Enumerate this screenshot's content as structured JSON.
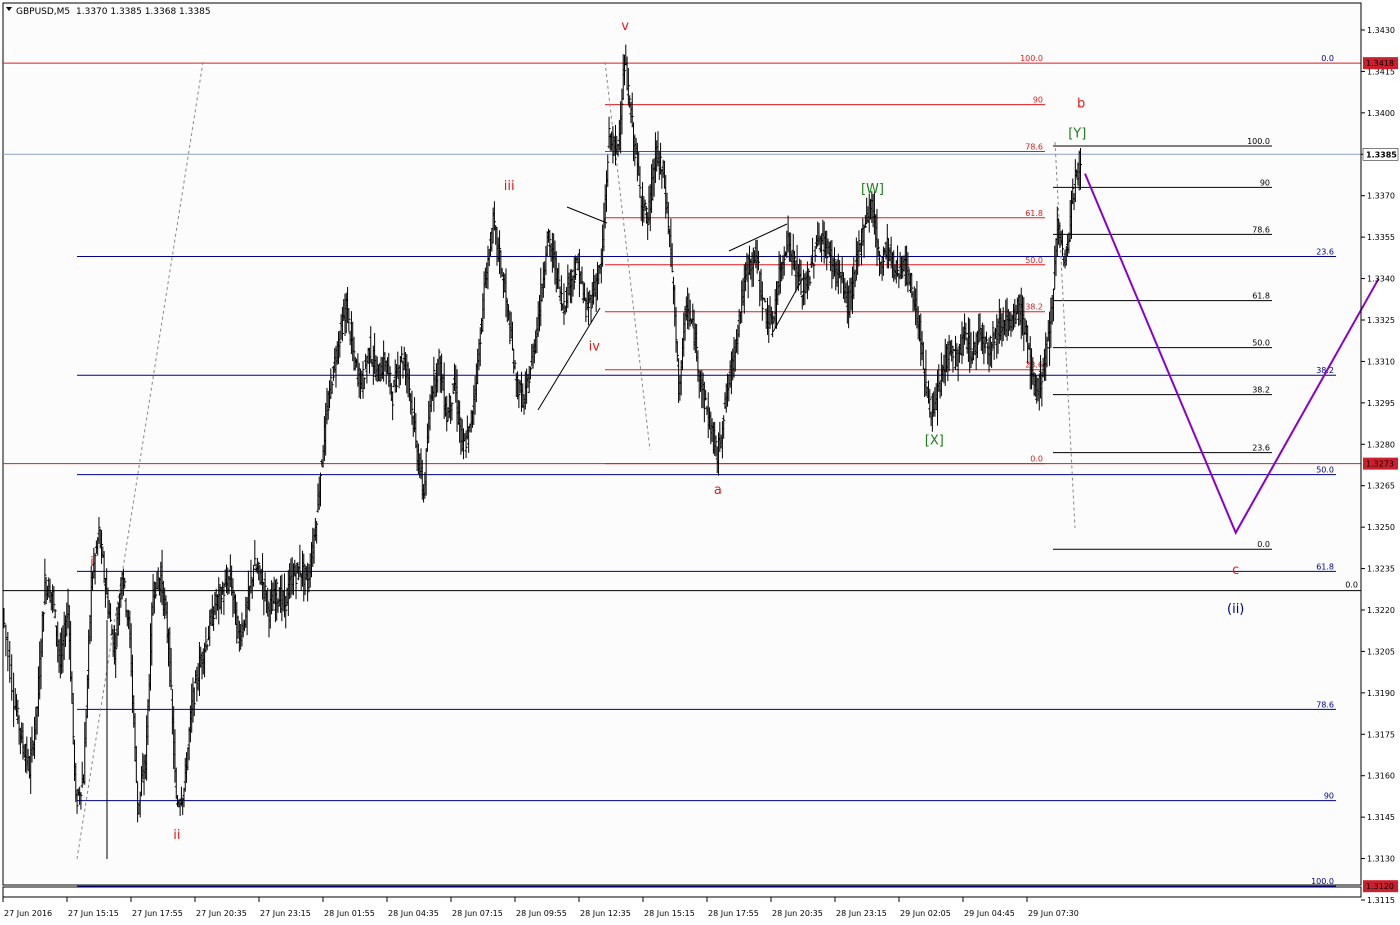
{
  "header": {
    "symbol": "GBPUSD,M5",
    "ohlc": "1.3370 1.3385 1.3368 1.3385"
  },
  "colors": {
    "bull": "#000000",
    "bear": "#000000",
    "fib_red": "#e31a1c",
    "fib_blue": "#00008b",
    "fib_black": "#000000",
    "bid_line": "#8da2c7",
    "projection": "#8b00c8",
    "wave_red": "#e31a1c",
    "wave_green": "#1e7d1e",
    "wave_blue": "#00008b",
    "trend_dotted": "#888888",
    "price_badge_bg": "#cc1f2d"
  },
  "chart_data": {
    "type": "candlestick",
    "symbol": "GBPUSD",
    "timeframe": "M5",
    "title": "GBPUSD,M5",
    "last_ohlc": {
      "open": 1.337,
      "high": 1.3385,
      "low": 1.3368,
      "close": 1.3385
    },
    "ylim": [
      1.3108,
      1.3442
    ],
    "y_ticks": [
      "1.3430",
      "1.3415",
      "1.3400",
      "1.3385",
      "1.3370",
      "1.3355",
      "1.3340",
      "1.3325",
      "1.3310",
      "1.3295",
      "1.3280",
      "1.3265",
      "1.3250",
      "1.3235",
      "1.3220",
      "1.3205",
      "1.3190",
      "1.3175",
      "1.3160",
      "1.3145",
      "1.3130",
      "1.3115"
    ],
    "x_ticks": [
      "27 Jun 2016",
      "27 Jun 15:15",
      "27 Jun 17:55",
      "27 Jun 20:35",
      "27 Jun 23:15",
      "28 Jun 01:55",
      "28 Jun 04:35",
      "28 Jun 07:15",
      "28 Jun 09:55",
      "28 Jun 12:35",
      "28 Jun 15:15",
      "28 Jun 17:55",
      "28 Jun 20:35",
      "28 Jun 23:15",
      "29 Jun 02:05",
      "29 Jun 04:45",
      "29 Jun 07:30"
    ],
    "price_badges": [
      {
        "label": "1.3418",
        "price": 1.3418,
        "style": "red"
      },
      {
        "label": "1.3385",
        "price": 1.3385,
        "style": "current"
      },
      {
        "label": "1.3273",
        "price": 1.3273,
        "style": "red"
      },
      {
        "label": "1.3120",
        "price": 1.312,
        "style": "red"
      }
    ],
    "bid_price": 1.3385,
    "path": [
      [
        0,
        1.322
      ],
      [
        3,
        1.3188
      ],
      [
        5,
        1.3173
      ],
      [
        7,
        1.3162
      ],
      [
        9,
        1.3185
      ],
      [
        11,
        1.323
      ],
      [
        13,
        1.3225
      ],
      [
        15,
        1.32
      ],
      [
        17,
        1.3222
      ],
      [
        19,
        1.315
      ],
      [
        21,
        1.316
      ],
      [
        23,
        1.323
      ],
      [
        25,
        1.3248
      ],
      [
        27,
        1.3225
      ],
      [
        29,
        1.3205
      ],
      [
        31,
        1.3235
      ],
      [
        33,
        1.321
      ],
      [
        35,
        1.3148
      ],
      [
        37,
        1.3165
      ],
      [
        39,
        1.3228
      ],
      [
        41,
        1.3232
      ],
      [
        43,
        1.3208
      ],
      [
        45,
        1.315
      ],
      [
        47,
        1.3155
      ],
      [
        49,
        1.3185
      ],
      [
        51,
        1.32
      ],
      [
        53,
        1.321
      ],
      [
        55,
        1.3222
      ],
      [
        57,
        1.3226
      ],
      [
        59,
        1.3232
      ],
      [
        61,
        1.321
      ],
      [
        63,
        1.3218
      ],
      [
        65,
        1.3236
      ],
      [
        67,
        1.3232
      ],
      [
        69,
        1.322
      ],
      [
        71,
        1.3226
      ],
      [
        73,
        1.3222
      ],
      [
        75,
        1.3232
      ],
      [
        77,
        1.3235
      ],
      [
        79,
        1.323
      ],
      [
        81,
        1.325
      ],
      [
        83,
        1.328
      ],
      [
        85,
        1.3302
      ],
      [
        87,
        1.3318
      ],
      [
        89,
        1.333
      ],
      [
        91,
        1.331
      ],
      [
        93,
        1.3302
      ],
      [
        95,
        1.3315
      ],
      [
        97,
        1.3305
      ],
      [
        99,
        1.331
      ],
      [
        101,
        1.3298
      ],
      [
        103,
        1.3312
      ],
      [
        105,
        1.3305
      ],
      [
        107,
        1.328
      ],
      [
        109,
        1.3262
      ],
      [
        111,
        1.33
      ],
      [
        113,
        1.331
      ],
      [
        115,
        1.329
      ],
      [
        117,
        1.3302
      ],
      [
        119,
        1.3278
      ],
      [
        121,
        1.3285
      ],
      [
        123,
        1.331
      ],
      [
        125,
        1.334
      ],
      [
        127,
        1.336
      ],
      [
        129,
        1.3345
      ],
      [
        131,
        1.3325
      ],
      [
        133,
        1.3302
      ],
      [
        135,
        1.3295
      ],
      [
        137,
        1.331
      ],
      [
        139,
        1.333
      ],
      [
        141,
        1.3355
      ],
      [
        143,
        1.3345
      ],
      [
        145,
        1.333
      ],
      [
        147,
        1.334
      ],
      [
        149,
        1.3345
      ],
      [
        151,
        1.3328
      ],
      [
        153,
        1.3336
      ],
      [
        155,
        1.3345
      ],
      [
        157,
        1.3392
      ],
      [
        159,
        1.3385
      ],
      [
        161,
        1.3418
      ],
      [
        163,
        1.3395
      ],
      [
        165,
        1.3372
      ],
      [
        167,
        1.336
      ],
      [
        169,
        1.3385
      ],
      [
        171,
        1.3378
      ],
      [
        173,
        1.335
      ],
      [
        175,
        1.33
      ],
      [
        177,
        1.333
      ],
      [
        179,
        1.332
      ],
      [
        181,
        1.33
      ],
      [
        183,
        1.3288
      ],
      [
        185,
        1.3275
      ],
      [
        187,
        1.3295
      ],
      [
        189,
        1.331
      ],
      [
        191,
        1.333
      ],
      [
        193,
        1.3345
      ],
      [
        195,
        1.3348
      ],
      [
        197,
        1.333
      ],
      [
        199,
        1.3322
      ],
      [
        201,
        1.334
      ],
      [
        203,
        1.3355
      ],
      [
        205,
        1.3345
      ],
      [
        207,
        1.3335
      ],
      [
        209,
        1.3342
      ],
      [
        211,
        1.3355
      ],
      [
        213,
        1.3352
      ],
      [
        215,
        1.3345
      ],
      [
        217,
        1.334
      ],
      [
        219,
        1.333
      ],
      [
        221,
        1.3345
      ],
      [
        223,
        1.336
      ],
      [
        225,
        1.3368
      ],
      [
        227,
        1.3345
      ],
      [
        229,
        1.3352
      ],
      [
        231,
        1.3342
      ],
      [
        233,
        1.3346
      ],
      [
        235,
        1.3338
      ],
      [
        237,
        1.3325
      ],
      [
        239,
        1.33
      ],
      [
        241,
        1.329
      ],
      [
        243,
        1.3305
      ],
      [
        245,
        1.3315
      ],
      [
        247,
        1.331
      ],
      [
        249,
        1.332
      ],
      [
        251,
        1.3312
      ],
      [
        253,
        1.3322
      ],
      [
        255,
        1.3315
      ],
      [
        257,
        1.332
      ],
      [
        259,
        1.3326
      ],
      [
        261,
        1.3322
      ],
      [
        263,
        1.333
      ],
      [
        265,
        1.332
      ],
      [
        267,
        1.3298
      ],
      [
        269,
        1.3305
      ],
      [
        271,
        1.332
      ],
      [
        273,
        1.336
      ],
      [
        275,
        1.3345
      ],
      [
        277,
        1.337
      ],
      [
        279,
        1.3385
      ]
    ],
    "fib_red_left": {
      "x_start": 0,
      "x_end": 1362,
      "levels": [
        {
          "label": "100.0",
          "price": 1.3418
        },
        {
          "label": "0.0",
          "price": 1.3273
        }
      ]
    },
    "fib_red_mid": {
      "levels": [
        {
          "label": "90",
          "price": 1.3403
        },
        {
          "label": "78.6",
          "price": 1.3386
        },
        {
          "label": "61.8",
          "price": 1.3362
        },
        {
          "label": "50.0",
          "price": 1.3345
        },
        {
          "label": "38.2",
          "price": 1.3328
        },
        {
          "label": "23.6",
          "price": 1.3307
        },
        {
          "label": "0.0",
          "price": 1.3273
        }
      ],
      "right_labels": [
        {
          "label": "100.0",
          "price": 1.3418,
          "pos": "left"
        },
        {
          "label": "0.0",
          "price": 1.3418,
          "pos": "right"
        }
      ]
    },
    "fib_blue": {
      "levels": [
        {
          "label": "23.6",
          "price": 1.3348
        },
        {
          "label": "38.2",
          "price": 1.3305
        },
        {
          "label": "50.0",
          "price": 1.3269
        },
        {
          "label": "61.8",
          "price": 1.3234
        },
        {
          "label": "78.6",
          "price": 1.3184
        },
        {
          "label": "90",
          "price": 1.3151
        },
        {
          "label": "100.0",
          "price": 1.312
        }
      ]
    },
    "fib_black": {
      "levels": [
        {
          "label": "100.0",
          "price": 1.3388
        },
        {
          "label": "90",
          "price": 1.3373
        },
        {
          "label": "78.6",
          "price": 1.3356
        },
        {
          "label": "61.8",
          "price": 1.3332
        },
        {
          "label": "50.0",
          "price": 1.3315
        },
        {
          "label": "38.2",
          "price": 1.3298
        },
        {
          "label": "23.6",
          "price": 1.3277
        },
        {
          "label": "0.0",
          "price": 1.3242
        }
      ]
    },
    "black_level": {
      "label": "0.0",
      "price": 1.3227
    },
    "wave_labels": [
      {
        "text": "i",
        "color": "red",
        "x": 23,
        "price": 1.3236
      },
      {
        "text": "ii",
        "color": "red",
        "x": 45,
        "price": 1.3137
      },
      {
        "text": "iii",
        "color": "red",
        "x": 131,
        "price": 1.3372
      },
      {
        "text": "iv",
        "color": "red",
        "x": 153,
        "price": 1.3314
      },
      {
        "text": "v",
        "color": "red",
        "x": 161,
        "price": 1.343
      },
      {
        "text": "a",
        "color": "red",
        "x": 185,
        "price": 1.3262
      },
      {
        "text": "b",
        "color": "red",
        "x": 279,
        "price": 1.3402
      },
      {
        "text": "[W]",
        "color": "green",
        "x": 225,
        "price": 1.3371
      },
      {
        "text": "[X]",
        "color": "green",
        "x": 241,
        "price": 1.328
      },
      {
        "text": "[Y]",
        "color": "green",
        "x": 278,
        "price": 1.3391
      },
      {
        "text": "c",
        "color": "red",
        "x": 319,
        "price": 1.3233
      },
      {
        "text": "(ii)",
        "color": "blue",
        "x": 319,
        "price": 1.3219
      }
    ],
    "projection": [
      [
        280,
        1.3378
      ],
      [
        319,
        1.3248
      ],
      [
        356,
        1.334
      ]
    ]
  }
}
